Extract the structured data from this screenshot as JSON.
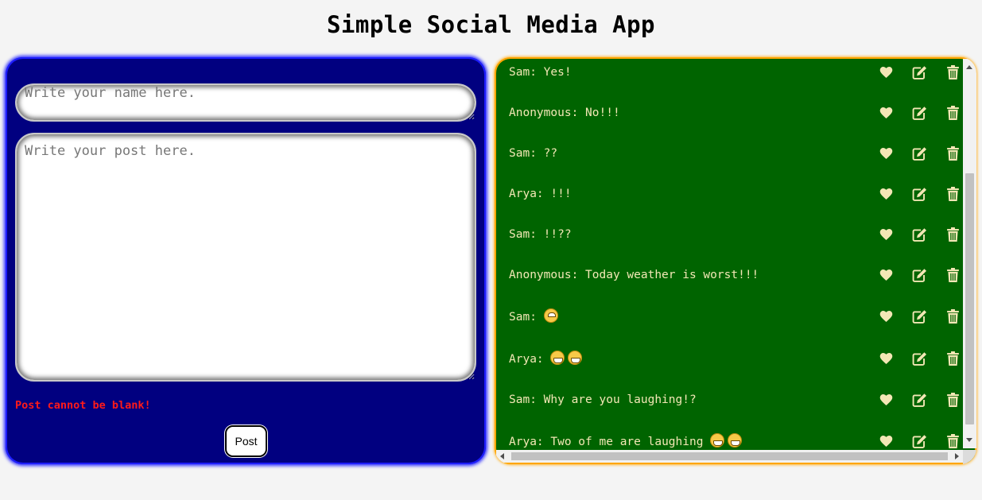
{
  "app": {
    "title": "Simple Social Media App"
  },
  "compose": {
    "name_placeholder": "Write your name here.",
    "post_placeholder": "Write your post here.",
    "error_message": "Post cannot be blank!",
    "post_button_label": "Post"
  },
  "feed": {
    "posts": [
      {
        "author": "Sam",
        "text": "Yes!",
        "emojis": []
      },
      {
        "author": "Anonymous",
        "text": "No!!!",
        "emojis": []
      },
      {
        "author": "Sam",
        "text": "??",
        "emojis": []
      },
      {
        "author": "Arya",
        "text": "!!!",
        "emojis": []
      },
      {
        "author": "Sam",
        "text": "!!??",
        "emojis": []
      },
      {
        "author": "Anonymous",
        "text": "Today weather is worst!!!",
        "emojis": []
      },
      {
        "author": "Sam",
        "text": "",
        "emojis": [
          "🙄"
        ]
      },
      {
        "author": "Arya",
        "text": "",
        "emojis": [
          "😁",
          "😁"
        ]
      },
      {
        "author": "Sam",
        "text": "Why are you laughing!?",
        "emojis": []
      },
      {
        "author": "Arya",
        "text": "Two of me are laughing",
        "emojis": [
          "😁",
          "😁"
        ]
      }
    ],
    "action_icons": [
      "heart-icon",
      "edit-icon",
      "trash-icon"
    ]
  },
  "colors": {
    "page_bg": "#f4f4f4",
    "compose_bg": "#010080",
    "feed_bg": "#006400",
    "feed_border": "#ffa500",
    "feed_text": "#f3e7b5",
    "icon_color": "#f3e7b5",
    "error_text": "#ff1a1a"
  }
}
